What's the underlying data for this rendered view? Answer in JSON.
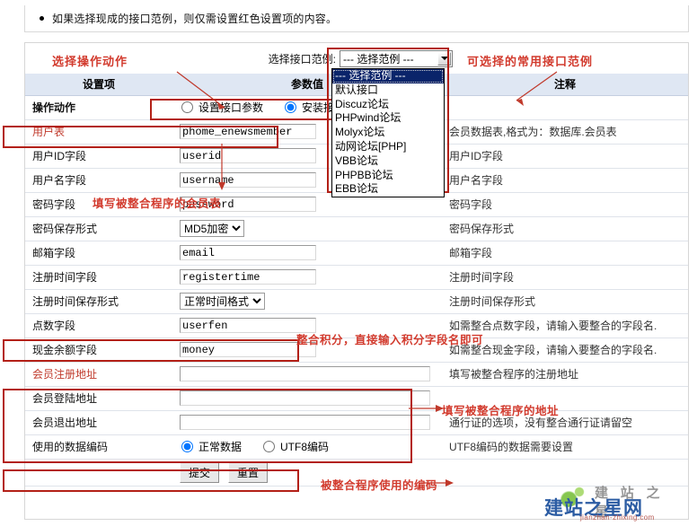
{
  "notice": {
    "bullet_text": "如果选择现成的接口范例，则仅需设置红色设置项的内容。"
  },
  "toolbar": {
    "select_label": "选择接口范例:",
    "combo_value": "---  选择范例  ---",
    "options": [
      "---  选择范例  ---",
      "默认接口",
      "Discuz论坛",
      "PHPwind论坛",
      "Molyx论坛",
      "动网论坛[PHP]",
      "VBB论坛",
      "PHPBB论坛",
      "EBB论坛"
    ],
    "selected_index": 0
  },
  "table": {
    "headers": {
      "col_setting": "设置项",
      "col_value": "参数值",
      "col_note": "注释"
    },
    "rows": [
      {
        "label": "操作动作",
        "label_style": "bold",
        "type": "radio",
        "radios": [
          {
            "text": "设置接口参数",
            "checked": false
          },
          {
            "text": "安装接口",
            "checked": true
          }
        ],
        "note": ""
      },
      {
        "label": "用户表",
        "label_style": "red",
        "type": "text",
        "value": "phome_enewsmember",
        "width": "w150",
        "note": "会员数据表,格式为：数据库.会员表"
      },
      {
        "label": "用户ID字段",
        "label_style": "normal",
        "type": "text",
        "value": "userid",
        "width": "w150",
        "note": "用户ID字段"
      },
      {
        "label": "用户名字段",
        "label_style": "normal",
        "type": "text",
        "value": "username",
        "width": "w150",
        "note": "用户名字段"
      },
      {
        "label": "密码字段",
        "label_style": "normal",
        "type": "text",
        "value": "password",
        "width": "w150",
        "note": "密码字段"
      },
      {
        "label": "密码保存形式",
        "label_style": "normal",
        "type": "select",
        "value": "MD5加密",
        "note": "密码保存形式"
      },
      {
        "label": "邮箱字段",
        "label_style": "normal",
        "type": "text",
        "value": "email",
        "width": "w150",
        "note": "邮箱字段"
      },
      {
        "label": "注册时间字段",
        "label_style": "normal",
        "type": "text",
        "value": "registertime",
        "width": "w150",
        "note": "注册时间字段"
      },
      {
        "label": "注册时间保存形式",
        "label_style": "normal",
        "type": "select",
        "value": "正常时间格式",
        "note": "注册时间保存形式"
      },
      {
        "label": "点数字段",
        "label_style": "normal",
        "type": "text",
        "value": "userfen",
        "width": "w150",
        "note": "如需整合点数字段，请输入要整合的字段名."
      },
      {
        "label": "现金余额字段",
        "label_style": "normal",
        "type": "text",
        "value": "money",
        "width": "w150",
        "note": "如需整合现金字段，请输入要整合的字段名."
      },
      {
        "label": "会员注册地址",
        "label_style": "red",
        "type": "text",
        "value": "",
        "width": "w280",
        "note": "填写被整合程序的注册地址"
      },
      {
        "label": "会员登陆地址",
        "label_style": "normal",
        "type": "text",
        "value": "",
        "width": "w280",
        "note": ""
      },
      {
        "label": "会员退出地址",
        "label_style": "normal",
        "type": "text",
        "value": "",
        "width": "w280",
        "note": "通行证的选项，没有整合通行证请留空"
      },
      {
        "label": "使用的数据编码",
        "label_style": "normal",
        "type": "radio",
        "radios": [
          {
            "text": "正常数据",
            "checked": true
          },
          {
            "text": "UTF8编码",
            "checked": false
          }
        ],
        "note": "UTF8编码的数据需要设置"
      },
      {
        "label": "",
        "label_style": "normal",
        "type": "buttons",
        "buttons": [
          "提交",
          "重置"
        ],
        "note": ""
      }
    ]
  },
  "annotations": [
    {
      "id": "anno-action",
      "text": "选择操作动作"
    },
    {
      "id": "anno-examples",
      "text": "可选择的常用接口范例"
    },
    {
      "id": "anno-member",
      "text": "填写被整合程序的会员表"
    },
    {
      "id": "anno-points",
      "text": "整合积分，直接输入积分字段名即可"
    },
    {
      "id": "anno-address",
      "text": "填写被整合程序的地址"
    },
    {
      "id": "anno-encoding",
      "text": "被整合程序使用的编码"
    }
  ],
  "watermark": {
    "line1": "建 站 之 星",
    "line2": "建站之星网",
    "line3": "jianzhan-zhixing.com"
  },
  "colors": {
    "header_bg": "#dfe7f3",
    "annotation_red": "#d23b2e",
    "box_red": "#b32017",
    "select_highlight": "#0a246a"
  }
}
